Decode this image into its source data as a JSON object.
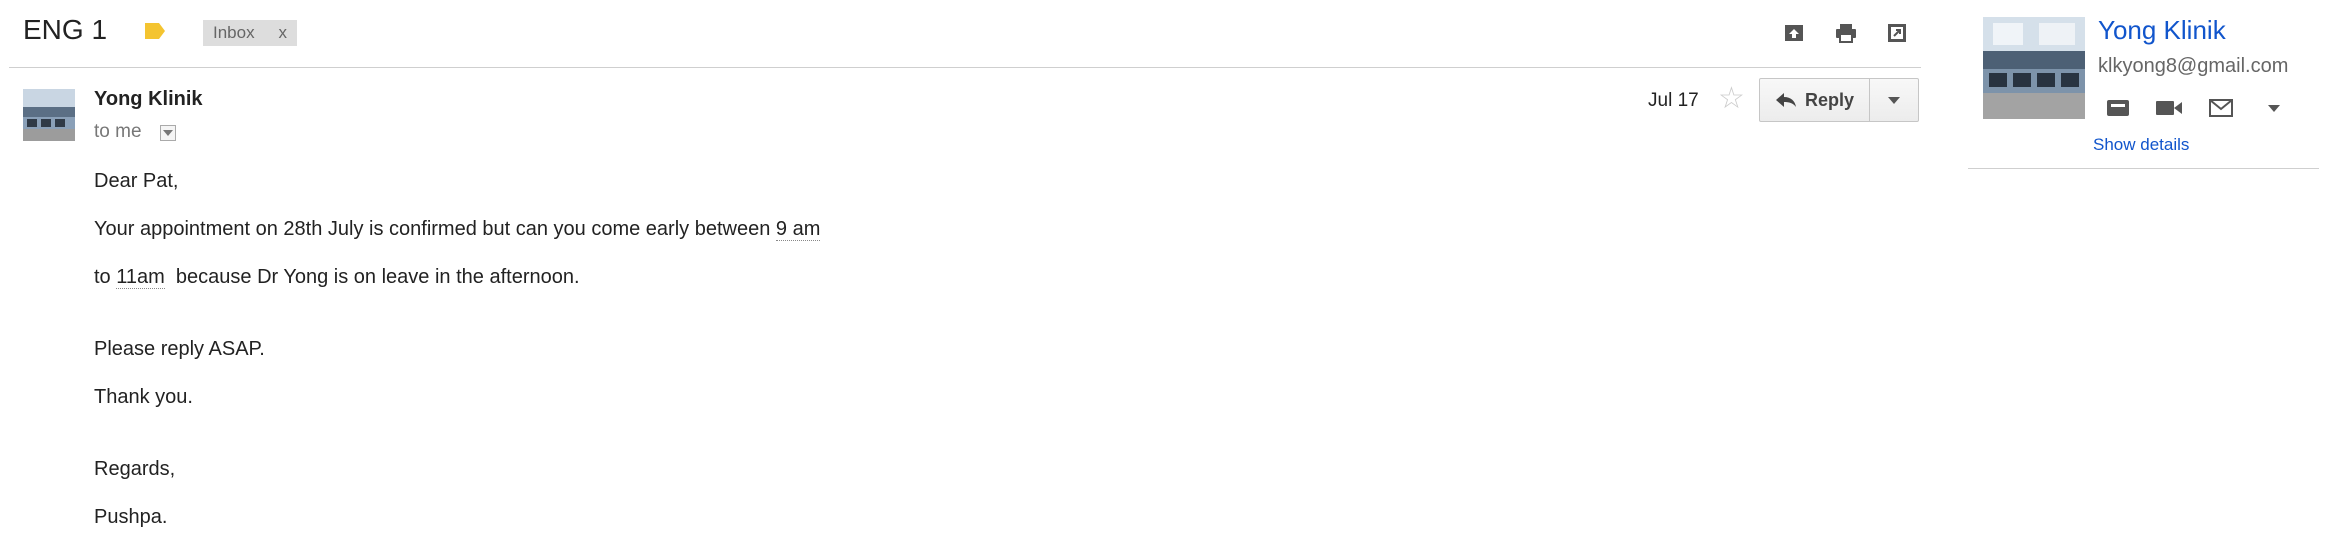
{
  "header": {
    "subject": "ENG 1",
    "label_chip": "Inbox",
    "label_chip_close": "x",
    "label_color": "#f4c430"
  },
  "message": {
    "sender_name": "Yong Klinik",
    "recipient": "to me",
    "date": "Jul 17",
    "reply_label": "Reply",
    "body": {
      "greeting": "Dear Pat,",
      "line1_prefix": "Your appointment on 28th July is confirmed but can you come early between ",
      "line1_time": "9 am",
      "line2_prefix": "to ",
      "line2_time": "11am",
      "line2_suffix": "  because Dr Yong is on leave in the afternoon.",
      "line3": "Please reply ASAP.",
      "line4": "Thank you.",
      "closing": "Regards,",
      "signature": "Pushpa."
    }
  },
  "contact_panel": {
    "name": "Yong Klinik",
    "email": "klkyong8@gmail.com",
    "show_details": "Show details"
  },
  "colors": {
    "link_blue": "#1155cc",
    "star_inactive": "#cccccc"
  },
  "icons": [
    "tag-icon",
    "archive-icon",
    "print-icon",
    "new-window-icon",
    "star-icon",
    "reply-arrow-icon",
    "chevron-down-icon",
    "mail-icon",
    "video-icon",
    "envelope-icon"
  ]
}
